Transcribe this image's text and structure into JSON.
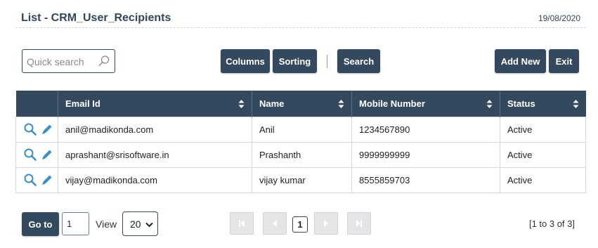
{
  "page": {
    "title": "List - CRM_User_Recipients",
    "date": "19/08/2020"
  },
  "toolbar": {
    "search_placeholder": "Quick search",
    "columns_label": "Columns",
    "sorting_label": "Sorting",
    "search_label": "Search",
    "add_new_label": "Add New",
    "exit_label": "Exit"
  },
  "table": {
    "columns": [
      "",
      "Email Id",
      "Name",
      "Mobile Number",
      "Status"
    ],
    "rows": [
      {
        "email": "anil@madikonda.com",
        "name": "Anil",
        "mobile": "1234567890",
        "status": "Active"
      },
      {
        "email": "aprashant@srisoftware.in",
        "name": "Prashanth",
        "mobile": "9999999999",
        "status": "Active"
      },
      {
        "email": "vijay@madikonda.com",
        "name": "vijay kumar",
        "mobile": "8555859703",
        "status": "Active"
      }
    ]
  },
  "pagination": {
    "goto_label": "Go to",
    "goto_value": "1",
    "view_label": "View",
    "page_size": "20",
    "current_page": "1",
    "range_text": "[1 to 3 of 3]"
  },
  "colors": {
    "primary": "#34495e",
    "title": "#33465c",
    "icon_blue": "#3a8fc7"
  },
  "icons": {
    "search": "magnifier-icon",
    "view": "magnifier-icon",
    "edit": "pencil-icon",
    "sort": "sort-arrows-icon",
    "first": "first-page-icon",
    "prev": "previous-page-icon",
    "next": "next-page-icon",
    "last": "last-page-icon"
  }
}
